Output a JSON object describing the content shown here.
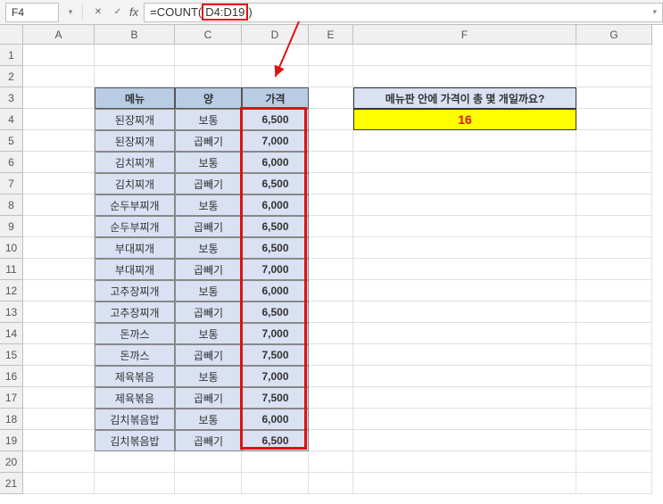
{
  "name_box": "F4",
  "formula_prefix": "=COUNT(",
  "formula_range": "D4:D19",
  "formula_suffix": ")",
  "columns": [
    "A",
    "B",
    "C",
    "D",
    "E",
    "F",
    "G"
  ],
  "row_count": 21,
  "headers": {
    "menu": "메뉴",
    "qty": "양",
    "price": "가격"
  },
  "rows": [
    {
      "menu": "된장찌개",
      "qty": "보통",
      "price": "6,500"
    },
    {
      "menu": "된장찌개",
      "qty": "곱빼기",
      "price": "7,000"
    },
    {
      "menu": "김치찌개",
      "qty": "보통",
      "price": "6,000"
    },
    {
      "menu": "김치찌개",
      "qty": "곱빼기",
      "price": "6,500"
    },
    {
      "menu": "순두부찌개",
      "qty": "보통",
      "price": "6,000"
    },
    {
      "menu": "순두부찌개",
      "qty": "곱빼기",
      "price": "6,500"
    },
    {
      "menu": "부대찌개",
      "qty": "보통",
      "price": "6,500"
    },
    {
      "menu": "부대찌개",
      "qty": "곱빼기",
      "price": "7,000"
    },
    {
      "menu": "고추장찌개",
      "qty": "보통",
      "price": "6,000"
    },
    {
      "menu": "고추장찌개",
      "qty": "곱빼기",
      "price": "6,500"
    },
    {
      "menu": "돈까스",
      "qty": "보통",
      "price": "7,000"
    },
    {
      "menu": "돈까스",
      "qty": "곱빼기",
      "price": "7,500"
    },
    {
      "menu": "제육볶음",
      "qty": "보통",
      "price": "7,000"
    },
    {
      "menu": "제육볶음",
      "qty": "곱빼기",
      "price": "7,500"
    },
    {
      "menu": "김치볶음밥",
      "qty": "보통",
      "price": "6,000"
    },
    {
      "menu": "김치볶음밥",
      "qty": "곱빼기",
      "price": "6,500"
    }
  ],
  "question": "메뉴판 안에 가격이 총 몇 개일까요?",
  "result": "16",
  "col_widths": {
    "A": 80,
    "B": 90,
    "C": 75,
    "D": 75,
    "E": 50,
    "F": 250,
    "G": 85
  },
  "selection": {
    "col": "D",
    "row_start": 4,
    "row_end": 19
  }
}
